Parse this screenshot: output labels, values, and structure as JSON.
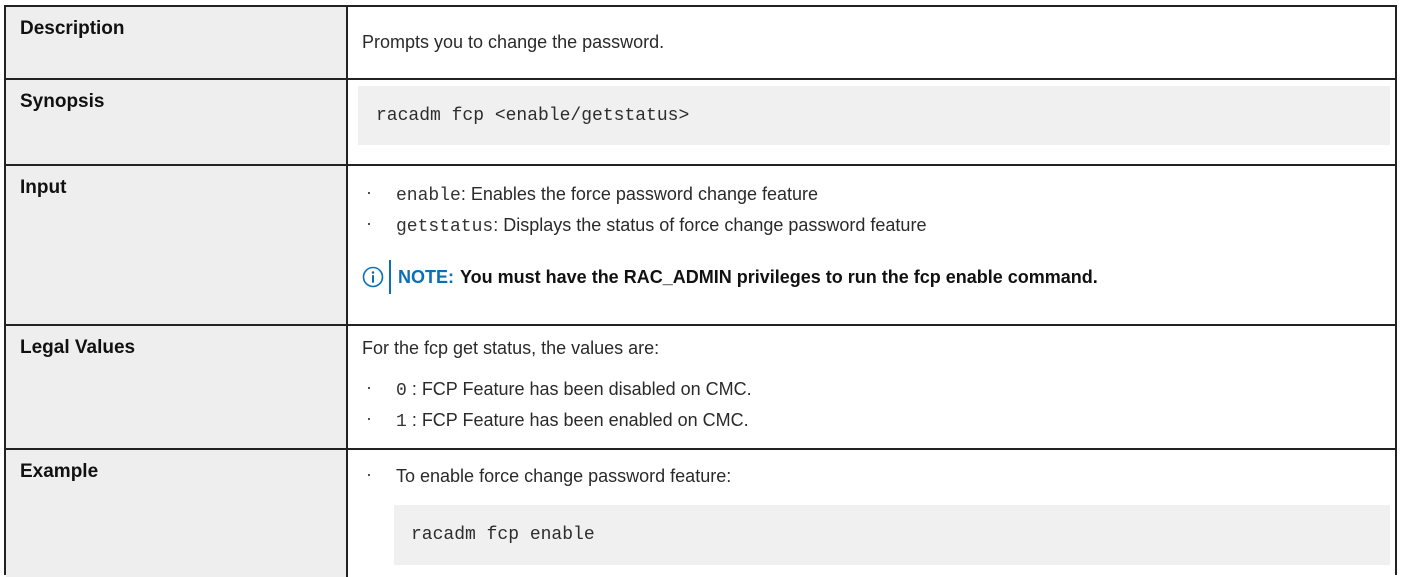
{
  "rows": {
    "description": {
      "label": "Description",
      "text": "Prompts you to change the password."
    },
    "synopsis": {
      "label": "Synopsis",
      "code": "racadm fcp <enable/getstatus>"
    },
    "input": {
      "label": "Input",
      "items": [
        {
          "term": "enable",
          "text": ": Enables the force password change feature"
        },
        {
          "term": "getstatus",
          "text": ": Displays the status of force change password feature"
        }
      ],
      "note": {
        "icon": "info-icon",
        "label": "NOTE:",
        "text": "You must have the RAC_ADMIN privileges to run the fcp enable command."
      }
    },
    "legal_values": {
      "label": "Legal Values",
      "intro": "For the fcp get status, the values are:",
      "items": [
        {
          "term": "0",
          "text": " : FCP Feature has been disabled on CMC."
        },
        {
          "term": "1",
          "text": " : FCP Feature has been enabled on CMC."
        }
      ]
    },
    "example": {
      "label": "Example",
      "item": "To enable force change password feature:",
      "code": "racadm fcp enable"
    }
  },
  "colors": {
    "border": "#222222",
    "label_bg": "#eeeeee",
    "code_bg": "#f0f0f0",
    "note_accent": "#0b6fb6"
  }
}
